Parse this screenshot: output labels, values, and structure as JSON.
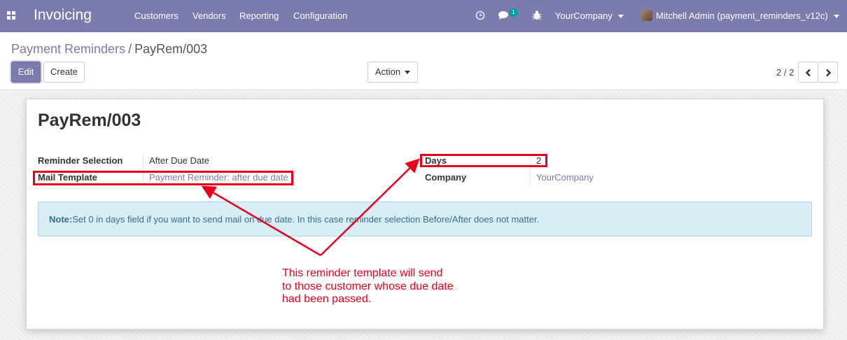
{
  "navbar": {
    "brand": "Invoicing",
    "menu": [
      "Customers",
      "Vendors",
      "Reporting",
      "Configuration"
    ],
    "icons": [
      "apps-grid-icon",
      "clock-icon",
      "chat-icon",
      "bug-icon"
    ],
    "message_count": "1",
    "company": "YourCompany",
    "user": "Mitchell Admin (payment_reminders_v12c)"
  },
  "breadcrumb": {
    "parent": "Payment Reminders",
    "separator": "/",
    "current": "PayRem/003"
  },
  "buttons": {
    "edit": "Edit",
    "create": "Create",
    "action": "Action"
  },
  "pager": {
    "value": "2 / 2",
    "icons": [
      "chevron-left-icon",
      "chevron-right-icon"
    ]
  },
  "record": {
    "title": "PayRem/003",
    "reminder_selection_label": "Reminder Selection",
    "reminder_selection_value": "After Due Date",
    "mail_template_label": "Mail Template",
    "mail_template_value": "Payment Reminder: after due date",
    "days_label": "Days",
    "days_value": "2",
    "company_label": "Company",
    "company_value": "YourCompany"
  },
  "note": {
    "prefix": "Note:",
    "text": "Set 0 in days field if you want to send mail on due date. In this case reminder selection Before/After does not matter."
  },
  "annotation": {
    "lines": [
      "This reminder template will send",
      "to those customer whose due date",
      "had been passed."
    ],
    "color": "#e8001c"
  },
  "colors": {
    "brand": "#7c7bad",
    "alert_bg": "#d9edf7",
    "alert_text": "#31708f",
    "badge": "#00a09d"
  }
}
